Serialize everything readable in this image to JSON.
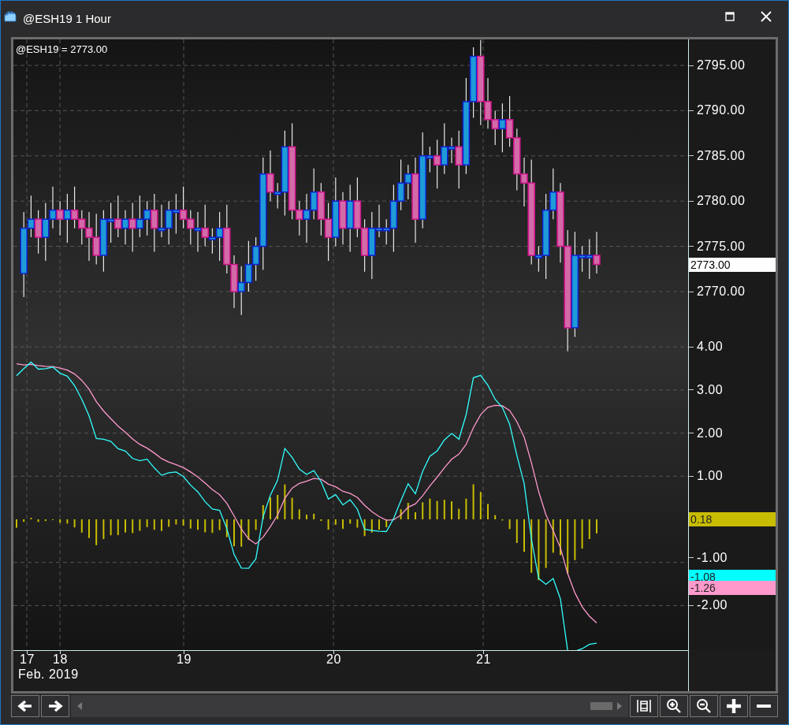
{
  "window": {
    "title": "@ESH19 1 Hour"
  },
  "chart": {
    "symbol_label": "@ESH19 = 2773.00",
    "price_axis": [
      "2795.00",
      "2790.00",
      "2785.00",
      "2780.00",
      "2775.00",
      "2770.00"
    ],
    "last_price": "2773.00",
    "macd_axis": [
      "4.00",
      "3.00",
      "2.00",
      "1.00",
      "-1.00",
      "-2.00"
    ],
    "macd_labels": [
      {
        "text": "0.18",
        "color": "#c8bc00"
      },
      {
        "text": "-1.08",
        "color": "#00ffff"
      },
      {
        "text": "-1.26",
        "color": "#ff99cc"
      }
    ],
    "date_axis": {
      "days": [
        "17",
        "18",
        "19",
        "20",
        "21"
      ],
      "month": "Feb. 2019"
    }
  },
  "toolbar": {
    "buttons": [
      {
        "kind": "back"
      },
      {
        "kind": "forward"
      },
      {
        "kind": "fit"
      },
      {
        "kind": "zoom-in"
      },
      {
        "kind": "zoom-out"
      },
      {
        "kind": "plus"
      },
      {
        "kind": "minus"
      }
    ]
  }
}
